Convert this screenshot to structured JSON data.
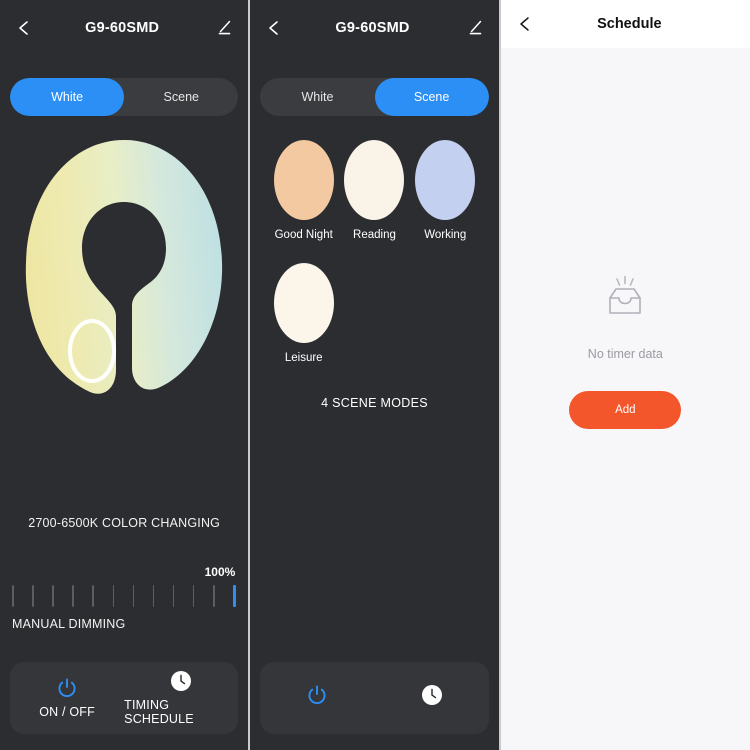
{
  "colors": {
    "dark_bg": "#2b2d30",
    "toggle_track": "#3a3c3f",
    "accent_blue": "#2b8ff5",
    "bottom_bar": "#343639",
    "light_bg": "#f7f7fa",
    "header_white": "#ffffff",
    "add_orange": "#f4562b",
    "wheel_warm": "#ede7a8",
    "wheel_cool": "#c5e3e0",
    "tick_off": "#5c5e61"
  },
  "panel_white_mode": {
    "header": {
      "back_icon": "back-chevron-icon",
      "title": "G9-60SMD",
      "edit_icon": "edit-pencil-icon"
    },
    "mode_toggle": {
      "options": [
        "White",
        "Scene"
      ],
      "selected": "White"
    },
    "color_wheel": {
      "name": "color-temperature-wheel",
      "handle_label": "color-temp-handle",
      "caption": "2700-6500K COLOR CHANGING"
    },
    "dimming": {
      "percent_label": "100%",
      "label": "MANUAL DIMMING",
      "tick_count": 12,
      "active_ticks": 1,
      "value": 100
    },
    "bottom_bar": {
      "items": [
        {
          "icon": "power-icon",
          "label": "ON / OFF"
        },
        {
          "icon": "clock-icon",
          "label": "TIMING SCHEDULE"
        }
      ]
    }
  },
  "panel_scene_mode": {
    "header": {
      "back_icon": "back-chevron-icon",
      "title": "G9-60SMD",
      "edit_icon": "edit-pencil-icon"
    },
    "mode_toggle": {
      "options": [
        "White",
        "Scene"
      ],
      "selected": "Scene"
    },
    "scenes": [
      {
        "name": "Good Night",
        "color": "#f2c9a0"
      },
      {
        "name": "Reading",
        "color": "#faf3e8"
      },
      {
        "name": "Working",
        "color": "#c3d0f0"
      },
      {
        "name": "Leisure",
        "color": "#fbf5ea"
      }
    ],
    "scene_count_label": "4 SCENE MODES",
    "bottom_bar": {
      "items": [
        {
          "icon": "power-icon",
          "label": ""
        },
        {
          "icon": "clock-icon",
          "label": ""
        }
      ]
    }
  },
  "panel_schedule": {
    "header": {
      "back_icon": "back-chevron-icon",
      "title": "Schedule"
    },
    "empty_state": {
      "icon": "empty-inbox-icon",
      "text": "No timer data"
    },
    "add_button": "Add"
  }
}
